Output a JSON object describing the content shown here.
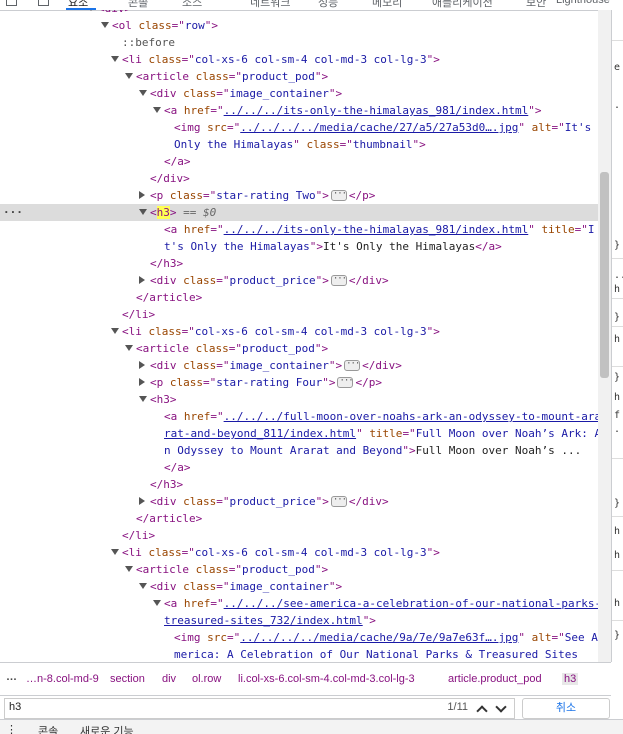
{
  "devtools_tabs": [
    "요소",
    "콘솔",
    "소스",
    "네트워크",
    "성능",
    "메모리",
    "애플리케이션",
    "보안",
    "Lighthouse"
  ],
  "dom_lines": [
    {
      "tokens": [
        [
          "tg",
          "<div>"
        ]
      ]
    },
    {
      "tokens": [
        [
          "tg",
          "<ol "
        ],
        [
          "an",
          "class"
        ],
        [
          "tg",
          "=\""
        ],
        [
          "av",
          "row"
        ],
        [
          "tg",
          "\">"
        ]
      ]
    },
    {
      "tokens": [
        [
          "ps",
          "::before"
        ]
      ]
    },
    {
      "tokens": [
        [
          "tg",
          "<li "
        ],
        [
          "an",
          "class"
        ],
        [
          "tg",
          "=\""
        ],
        [
          "av",
          "col-xs-6 col-sm-4 col-md-3 col-lg-3"
        ],
        [
          "tg",
          "\">"
        ]
      ]
    },
    {
      "tokens": [
        [
          "tg",
          "<article "
        ],
        [
          "an",
          "class"
        ],
        [
          "tg",
          "=\""
        ],
        [
          "av",
          "product_pod"
        ],
        [
          "tg",
          "\">"
        ]
      ]
    },
    {
      "tokens": [
        [
          "tg",
          "<div "
        ],
        [
          "an",
          "class"
        ],
        [
          "tg",
          "=\""
        ],
        [
          "av",
          "image_container"
        ],
        [
          "tg",
          "\">"
        ]
      ]
    },
    {
      "tokens": [
        [
          "tg",
          "<a "
        ],
        [
          "an",
          "href"
        ],
        [
          "tg",
          "=\""
        ],
        [
          "lk",
          "../../../its-only-the-himalayas_981/index.html"
        ],
        [
          "tg",
          "\">"
        ]
      ]
    },
    {
      "tokens": [
        [
          "tg",
          "<img "
        ],
        [
          "an",
          "src"
        ],
        [
          "tg",
          "=\""
        ],
        [
          "lk",
          "../../../../media/cache/27/a5/27a53d0….jpg"
        ],
        [
          "tg",
          "\" "
        ],
        [
          "an",
          "alt"
        ],
        [
          "tg",
          "=\""
        ],
        [
          "av",
          "It's"
        ]
      ]
    },
    {
      "tokens": [
        [
          "av",
          "Only the Himalayas"
        ],
        [
          "tg",
          "\" "
        ],
        [
          "an",
          "class"
        ],
        [
          "tg",
          "=\""
        ],
        [
          "av",
          "thumbnail"
        ],
        [
          "tg",
          "\">"
        ]
      ]
    },
    {
      "tokens": [
        [
          "tg",
          "</a>"
        ]
      ]
    },
    {
      "tokens": [
        [
          "tg",
          "</div>"
        ]
      ]
    },
    {
      "tokens": [
        [
          "tg",
          "<p "
        ],
        [
          "an",
          "class"
        ],
        [
          "tg",
          "=\""
        ],
        [
          "av",
          "star-rating Two"
        ],
        [
          "tg",
          "\">"
        ],
        [
          "ell",
          ""
        ],
        [
          "tg",
          "</p>"
        ]
      ]
    },
    {
      "tokens": [
        [
          "tg",
          "<"
        ],
        [
          "hl",
          "h3"
        ],
        [
          "tg",
          ">"
        ],
        [
          "dim",
          " == $0"
        ]
      ]
    },
    {
      "tokens": [
        [
          "tg",
          "<a "
        ],
        [
          "an",
          "href"
        ],
        [
          "tg",
          "=\""
        ],
        [
          "lk",
          "../../../its-only-the-himalayas_981/index.html"
        ],
        [
          "tg",
          "\" "
        ],
        [
          "an",
          "title"
        ],
        [
          "tg",
          "=\""
        ],
        [
          "av",
          "I"
        ]
      ]
    },
    {
      "tokens": [
        [
          "av",
          "t's Only the Himalayas"
        ],
        [
          "tg",
          "\">"
        ],
        [
          "tx",
          "It's Only the Himalayas"
        ],
        [
          "tg",
          "</a>"
        ]
      ]
    },
    {
      "tokens": [
        [
          "tg",
          "</h3>"
        ]
      ]
    },
    {
      "tokens": [
        [
          "tg",
          "<div "
        ],
        [
          "an",
          "class"
        ],
        [
          "tg",
          "=\""
        ],
        [
          "av",
          "product_price"
        ],
        [
          "tg",
          "\">"
        ],
        [
          "ell",
          ""
        ],
        [
          "tg",
          "</div>"
        ]
      ]
    },
    {
      "tokens": [
        [
          "tg",
          "</article>"
        ]
      ]
    },
    {
      "tokens": [
        [
          "tg",
          "</li>"
        ]
      ]
    },
    {
      "tokens": [
        [
          "tg",
          "<li "
        ],
        [
          "an",
          "class"
        ],
        [
          "tg",
          "=\""
        ],
        [
          "av",
          "col-xs-6 col-sm-4 col-md-3 col-lg-3"
        ],
        [
          "tg",
          "\">"
        ]
      ]
    },
    {
      "tokens": [
        [
          "tg",
          "<article "
        ],
        [
          "an",
          "class"
        ],
        [
          "tg",
          "=\""
        ],
        [
          "av",
          "product_pod"
        ],
        [
          "tg",
          "\">"
        ]
      ]
    },
    {
      "tokens": [
        [
          "tg",
          "<div "
        ],
        [
          "an",
          "class"
        ],
        [
          "tg",
          "=\""
        ],
        [
          "av",
          "image_container"
        ],
        [
          "tg",
          "\">"
        ],
        [
          "ell",
          ""
        ],
        [
          "tg",
          "</div>"
        ]
      ]
    },
    {
      "tokens": [
        [
          "tg",
          "<p "
        ],
        [
          "an",
          "class"
        ],
        [
          "tg",
          "=\""
        ],
        [
          "av",
          "star-rating Four"
        ],
        [
          "tg",
          "\">"
        ],
        [
          "ell",
          ""
        ],
        [
          "tg",
          "</p>"
        ]
      ]
    },
    {
      "tokens": [
        [
          "tg",
          "<h3>"
        ]
      ]
    },
    {
      "tokens": [
        [
          "tg",
          "<a "
        ],
        [
          "an",
          "href"
        ],
        [
          "tg",
          "=\""
        ],
        [
          "lk",
          "../../../full-moon-over-noahs-ark-an-odyssey-to-mount-ara"
        ]
      ]
    },
    {
      "tokens": [
        [
          "lk",
          "rat-and-beyond_811/index.html"
        ],
        [
          "tg",
          "\" "
        ],
        [
          "an",
          "title"
        ],
        [
          "tg",
          "=\""
        ],
        [
          "av",
          "Full Moon over Noah’s Ark: A"
        ]
      ]
    },
    {
      "tokens": [
        [
          "av",
          "n Odyssey to Mount Ararat and Beyond"
        ],
        [
          "tg",
          "\">"
        ],
        [
          "tx",
          "Full Moon over Noah’s ..."
        ]
      ]
    },
    {
      "tokens": [
        [
          "tg",
          "</a>"
        ]
      ]
    },
    {
      "tokens": [
        [
          "tg",
          "</h3>"
        ]
      ]
    },
    {
      "tokens": [
        [
          "tg",
          "<div "
        ],
        [
          "an",
          "class"
        ],
        [
          "tg",
          "=\""
        ],
        [
          "av",
          "product_price"
        ],
        [
          "tg",
          "\">"
        ],
        [
          "ell",
          ""
        ],
        [
          "tg",
          "</div>"
        ]
      ]
    },
    {
      "tokens": [
        [
          "tg",
          "</article>"
        ]
      ]
    },
    {
      "tokens": [
        [
          "tg",
          "</li>"
        ]
      ]
    },
    {
      "tokens": [
        [
          "tg",
          "<li "
        ],
        [
          "an",
          "class"
        ],
        [
          "tg",
          "=\""
        ],
        [
          "av",
          "col-xs-6 col-sm-4 col-md-3 col-lg-3"
        ],
        [
          "tg",
          "\">"
        ]
      ]
    },
    {
      "tokens": [
        [
          "tg",
          "<article "
        ],
        [
          "an",
          "class"
        ],
        [
          "tg",
          "=\""
        ],
        [
          "av",
          "product_pod"
        ],
        [
          "tg",
          "\">"
        ]
      ]
    },
    {
      "tokens": [
        [
          "tg",
          "<div "
        ],
        [
          "an",
          "class"
        ],
        [
          "tg",
          "=\""
        ],
        [
          "av",
          "image_container"
        ],
        [
          "tg",
          "\">"
        ]
      ]
    },
    {
      "tokens": [
        [
          "tg",
          "<a "
        ],
        [
          "an",
          "href"
        ],
        [
          "tg",
          "=\""
        ],
        [
          "lk",
          "../../../see-america-a-celebration-of-our-national-parks-"
        ]
      ]
    },
    {
      "tokens": [
        [
          "lk",
          "treasured-sites_732/index.html"
        ],
        [
          "tg",
          "\">"
        ]
      ]
    },
    {
      "tokens": [
        [
          "tg",
          "<img "
        ],
        [
          "an",
          "src"
        ],
        [
          "tg",
          "=\""
        ],
        [
          "lk",
          "../../../../media/cache/9a/7e/9a7e63f….jpg"
        ],
        [
          "tg",
          "\" "
        ],
        [
          "an",
          "alt"
        ],
        [
          "tg",
          "=\""
        ],
        [
          "av",
          "See A"
        ]
      ]
    },
    {
      "tokens": [
        [
          "av",
          "merica: A Celebration of Our National Parks & Treasured Sites"
        ]
      ]
    }
  ],
  "breadcrumbs": [
    "…n-8.col-md-9",
    "section",
    "div",
    "ol.row",
    "li.col-xs-6.col-sm-4.col-md-3.col-lg-3",
    "article.product_pod",
    "h3"
  ],
  "search": {
    "value": "h3",
    "count": "1/11",
    "cancel_label": "취소"
  },
  "drawer_tabs": [
    "콘솔",
    "새로운 기능"
  ],
  "side_fragments": [
    "e",
    ".",
    "}",
    "..",
    "h",
    "}",
    "h",
    "}",
    "h",
    "f",
    ".",
    "}",
    "h",
    "h",
    "h",
    "}",
    "}"
  ],
  "colors": {
    "selected_row": "#dcdcdc",
    "highlight": "#ffff54",
    "tag": "#881280",
    "attr_name": "#994500",
    "attr_value": "#1a1aa6"
  }
}
